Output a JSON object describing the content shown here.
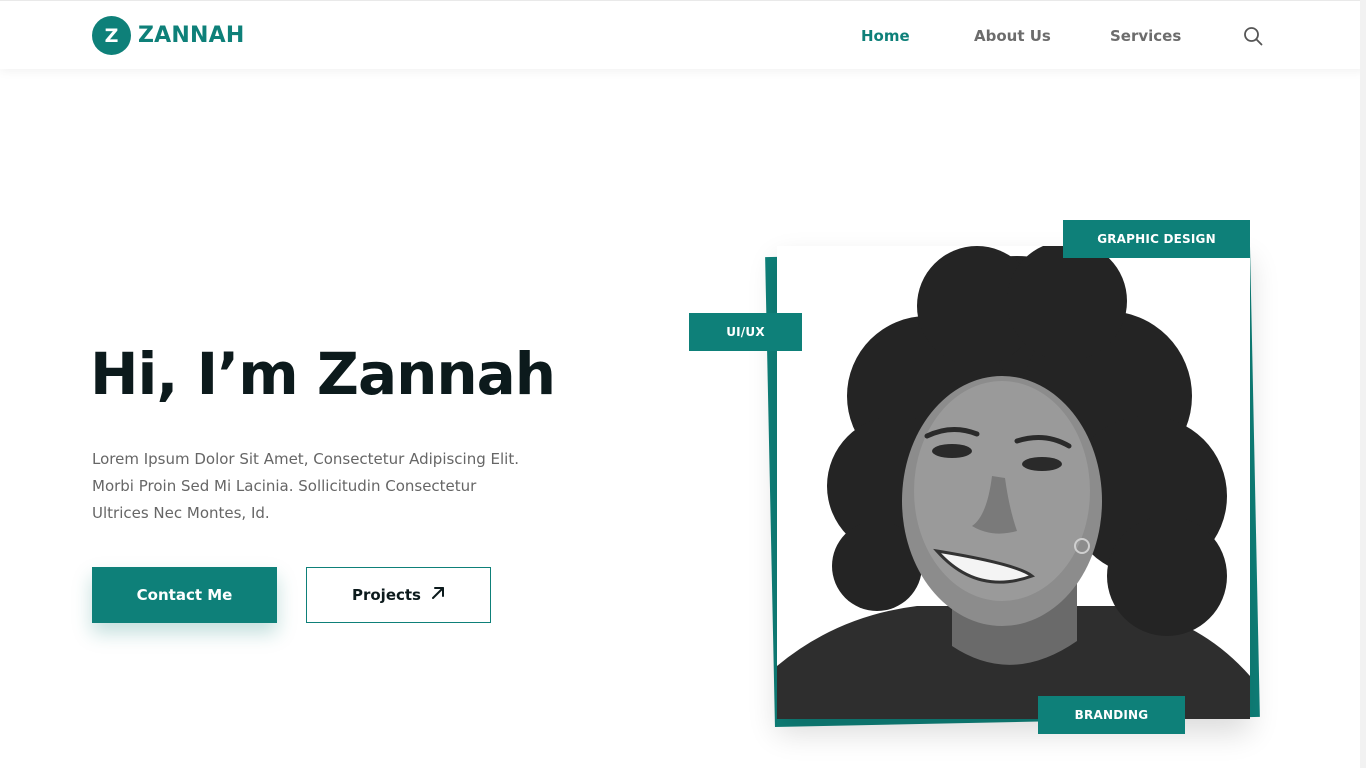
{
  "brand": {
    "mark": "Z",
    "name": "ZANNAH",
    "accent_color": "#0e8079"
  },
  "nav": {
    "items": [
      {
        "label": "Home",
        "active": true
      },
      {
        "label": "About Us",
        "active": false
      },
      {
        "label": "Services",
        "active": false
      }
    ],
    "search_icon": "search-icon"
  },
  "hero": {
    "title": "Hi, I’m Zannah",
    "description": "Lorem Ipsum Dolor Sit Amet, Consectetur Adipiscing Elit. Morbi Proin Sed Mi Lacinia. Sollicitudin Consectetur Ultrices Nec Montes, Id.",
    "primary_button": "Contact Me",
    "secondary_button": "Projects",
    "secondary_button_icon": "arrow-up-right-icon"
  },
  "photo": {
    "tags": [
      "GRAPHIC DESIGN",
      "UI/UX",
      "BRANDING"
    ]
  }
}
